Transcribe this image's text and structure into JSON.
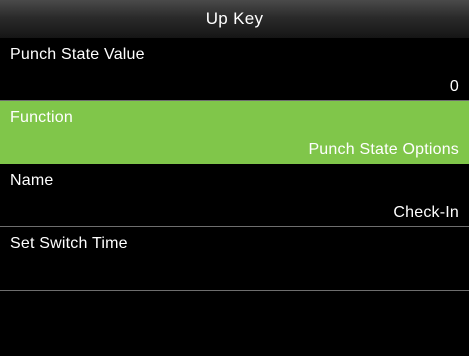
{
  "header": {
    "title": "Up Key"
  },
  "settings": [
    {
      "label": "Punch State Value",
      "value": "0"
    },
    {
      "label": "Function",
      "value": "Punch State Options",
      "selected": true
    },
    {
      "label": "Name",
      "value": "Check-In"
    },
    {
      "label": "Set Switch Time",
      "value": ""
    }
  ],
  "colors": {
    "background": "#000000",
    "selected": "#80c64a",
    "divider": "#6e6e6e",
    "text": "#ffffff"
  }
}
